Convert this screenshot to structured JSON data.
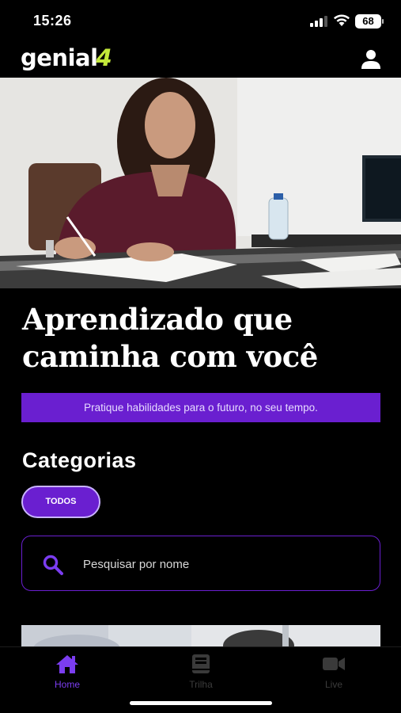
{
  "status_bar": {
    "time": "15:26",
    "battery": "68"
  },
  "header": {
    "logo_text": "genial",
    "logo_mark": "4",
    "profile_icon": "user-icon"
  },
  "hero": {
    "title_line1": "Aprendizado que",
    "title_line2": "caminha com você",
    "tagline": "Pratique habilidades para o futuro, no seu tempo."
  },
  "categories": {
    "title": "Categorias",
    "chips": [
      {
        "label": "TODOS",
        "selected": true
      }
    ]
  },
  "search": {
    "placeholder": "Pesquisar por nome",
    "value": "",
    "icon": "search-icon"
  },
  "tab_bar": {
    "items": [
      {
        "label": "Home",
        "icon": "home-icon",
        "active": true
      },
      {
        "label": "Trilha",
        "icon": "book-icon",
        "active": false
      },
      {
        "label": "Live",
        "icon": "video-camera-icon",
        "active": false
      }
    ]
  },
  "colors": {
    "accent": "#6a1fd0",
    "active_tab": "#7b3df0",
    "logo_mark": "#c3e83a",
    "background": "#000000"
  }
}
